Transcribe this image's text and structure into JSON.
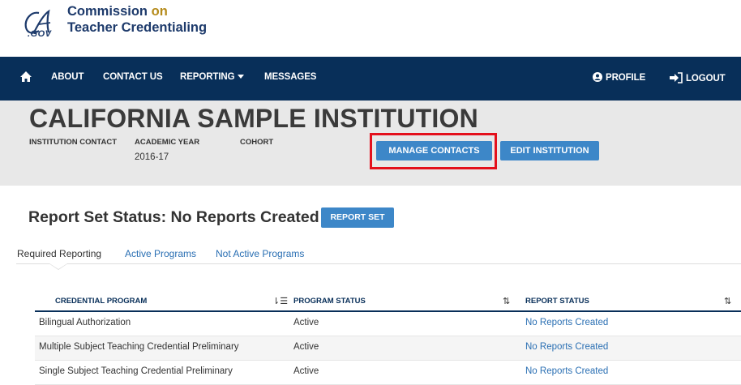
{
  "org": {
    "line1": "Commission",
    "line1_on": "on",
    "line2": "Teacher Credentialing",
    "gov": ".GOV"
  },
  "nav": {
    "about": "ABOUT",
    "contact": "CONTACT US",
    "reporting": "REPORTING",
    "messages": "MESSAGES",
    "profile": "PROFILE",
    "logout": "LOGOUT"
  },
  "institution": {
    "name": "CALIFORNIA SAMPLE INSTITUTION",
    "contact_label": "INSTITUTION CONTACT",
    "academic_year_label": "ACADEMIC YEAR",
    "academic_year": "2016-17",
    "cohort_label": "COHORT",
    "manage_contacts": "MANAGE CONTACTS",
    "edit_institution": "EDIT INSTITUTION"
  },
  "report_set": {
    "title": "Report Set Status: No Reports Created",
    "button": "REPORT SET"
  },
  "tabs": [
    {
      "label": "Required Reporting"
    },
    {
      "label": "Active Programs"
    },
    {
      "label": "Not Active Programs"
    }
  ],
  "table": {
    "headers": [
      "CREDENTIAL PROGRAM",
      "PROGRAM STATUS",
      "REPORT STATUS"
    ],
    "rows": [
      {
        "program": "Bilingual Authorization",
        "status": "Active",
        "report": "No Reports Created"
      },
      {
        "program": "Multiple Subject Teaching Credential Preliminary",
        "status": "Active",
        "report": "No Reports Created"
      },
      {
        "program": "Single Subject Teaching Credential Preliminary",
        "status": "Active",
        "report": "No Reports Created"
      }
    ]
  },
  "colors": {
    "navy": "#082f59",
    "button_blue": "#3d87c8",
    "highlight_red": "#e4101c",
    "link_blue": "#2a6fb3",
    "gold": "#b58b1b"
  }
}
